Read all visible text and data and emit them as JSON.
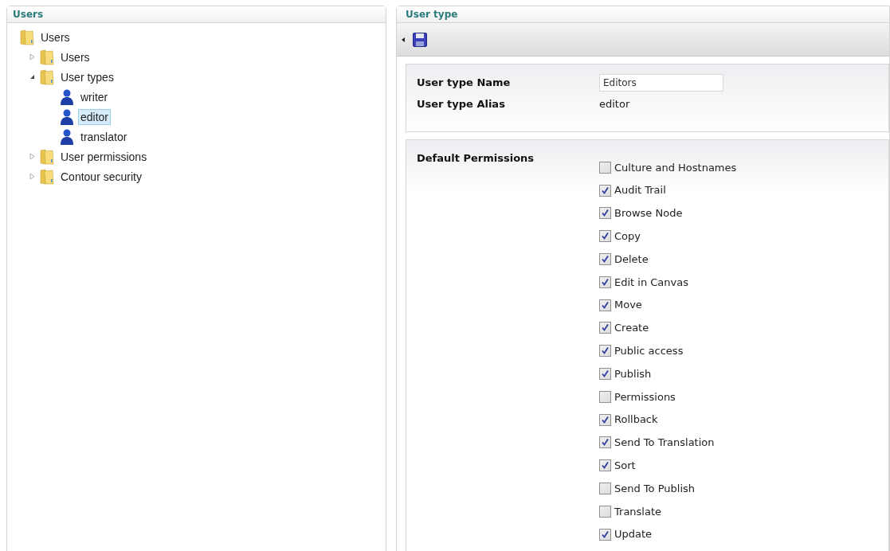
{
  "tree_panel": {
    "title": "Users",
    "tree": [
      {
        "label": "Users",
        "kind": "folder",
        "selected": false,
        "children": [
          {
            "label": "Users",
            "kind": "folder",
            "expanded": false,
            "selected": false
          },
          {
            "label": "User types",
            "kind": "folder",
            "expanded": true,
            "selected": false,
            "children": [
              {
                "label": "writer",
                "kind": "user",
                "selected": false
              },
              {
                "label": "editor",
                "kind": "user",
                "selected": true
              },
              {
                "label": "translator",
                "kind": "user",
                "selected": false
              }
            ]
          },
          {
            "label": "User permissions",
            "kind": "folder",
            "expanded": false,
            "selected": false
          },
          {
            "label": "Contour security",
            "kind": "folder",
            "expanded": false,
            "selected": false
          }
        ]
      }
    ]
  },
  "editor_panel": {
    "title": "User type",
    "fields": [
      {
        "label": "User type Name",
        "kind": "input",
        "value": "Editors"
      },
      {
        "label": "User type Alias",
        "kind": "text",
        "value": "editor"
      }
    ],
    "permissions_label": "Default Permissions",
    "permissions": [
      {
        "label": "Culture and Hostnames",
        "checked": false
      },
      {
        "label": "Audit Trail",
        "checked": true
      },
      {
        "label": "Browse Node",
        "checked": true
      },
      {
        "label": "Copy",
        "checked": true
      },
      {
        "label": "Delete",
        "checked": true
      },
      {
        "label": "Edit in Canvas",
        "checked": true
      },
      {
        "label": "Move",
        "checked": true
      },
      {
        "label": "Create",
        "checked": true
      },
      {
        "label": "Public access",
        "checked": true
      },
      {
        "label": "Publish",
        "checked": true
      },
      {
        "label": "Permissions",
        "checked": false
      },
      {
        "label": "Rollback",
        "checked": true
      },
      {
        "label": "Send To Translation",
        "checked": true
      },
      {
        "label": "Sort",
        "checked": true
      },
      {
        "label": "Send To Publish",
        "checked": false
      },
      {
        "label": "Translate",
        "checked": false
      },
      {
        "label": "Update",
        "checked": true
      }
    ]
  }
}
